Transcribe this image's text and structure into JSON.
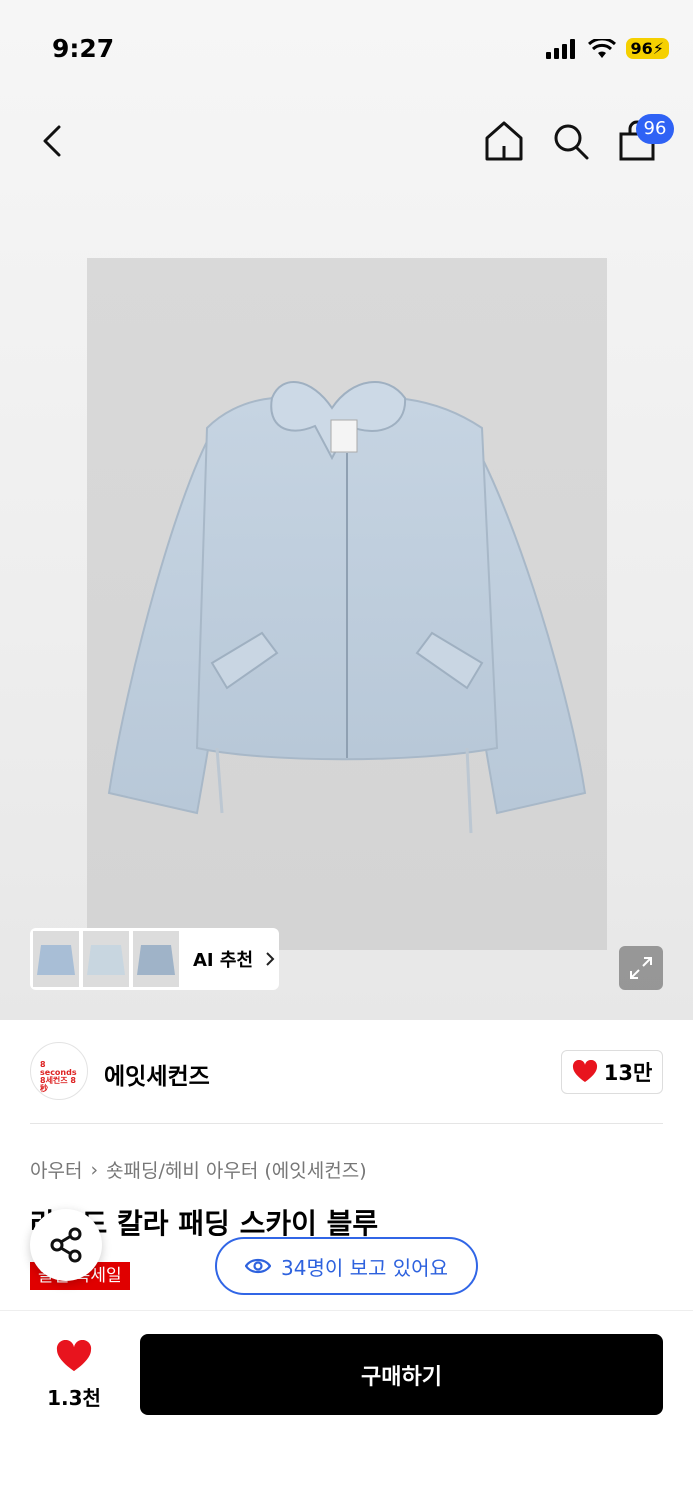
{
  "status_bar": {
    "time": "9:27",
    "battery": "96"
  },
  "nav": {
    "cart_badge": "96"
  },
  "gallery": {
    "ai_recommend_label": "AI 추천",
    "thumbnail_count": 3
  },
  "brand": {
    "logo_text": "8 seconds 8세컨즈 8秒",
    "name": "에잇세컨즈",
    "likes": "13만"
  },
  "product": {
    "breadcrumb": [
      "아우터",
      "숏패딩/헤비 아우터 (에잇세컨즈)"
    ],
    "title": "라운드 칼라 패딩 스카이 블루",
    "sale_badge": "올킬 특세일",
    "viewers": "34명이 보고 있어요"
  },
  "bottom_bar": {
    "wish_count": "1.3천",
    "buy_label": "구매하기"
  },
  "colors": {
    "accent_blue": "#2f62f5",
    "heart_red": "#e8141e",
    "sale_red": "#e00000"
  }
}
